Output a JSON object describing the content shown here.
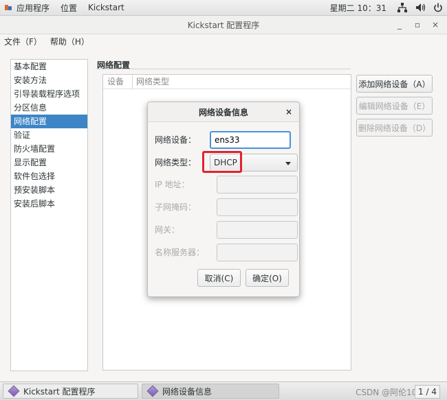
{
  "topbar": {
    "applications": "应用程序",
    "places": "位置",
    "app_name": "Kickstart",
    "clock": "星期二 10：31"
  },
  "window": {
    "title": "Kickstart 配置程序",
    "minimize": "_",
    "maximize": "▫",
    "close": "×"
  },
  "menu": {
    "file": "文件（F）",
    "help": "帮助（H）"
  },
  "sidebar": {
    "items": [
      {
        "label": "基本配置"
      },
      {
        "label": "安装方法"
      },
      {
        "label": "引导装载程序选项"
      },
      {
        "label": "分区信息"
      },
      {
        "label": "网络配置"
      },
      {
        "label": "验证"
      },
      {
        "label": "防火墙配置"
      },
      {
        "label": "显示配置"
      },
      {
        "label": "软件包选择"
      },
      {
        "label": "预安装脚本"
      },
      {
        "label": "安装后脚本"
      }
    ],
    "selected_index": 4
  },
  "network": {
    "group_title": "网络配置",
    "col_device": "设备",
    "col_type": "网络类型",
    "add_button": "添加网络设备（A）",
    "edit_button": "编辑网络设备（E）",
    "delete_button": "删除网络设备（D）"
  },
  "dialog": {
    "title": "网络设备信息",
    "close": "×",
    "device_label": "网络设备：",
    "device_value": "ens33",
    "type_label": "网络类型：",
    "type_value": "DHCP",
    "ip_label": "IP 地址：",
    "ip_value": "",
    "netmask_label": "子网掩码：",
    "netmask_value": "",
    "gateway_label": "网关：",
    "gateway_value": "",
    "dns_label": "名称服务器：",
    "dns_value": "",
    "cancel_button": "取消(C)",
    "ok_button": "确定(O)"
  },
  "taskbar": {
    "task1": "Kickstart 配置程序",
    "task2": "网络设备信息",
    "watermark": "CSDN @阿伦100",
    "pager": "1 / 4"
  },
  "colors": {
    "selection": "#3d85c6",
    "highlight_box": "#e0232e",
    "focus_border": "#4a90d9"
  },
  "icons": [
    "applications-icon",
    "network-icon",
    "volume-icon",
    "power-icon",
    "dropdown-arrow-icon",
    "app-diamond-icon"
  ]
}
